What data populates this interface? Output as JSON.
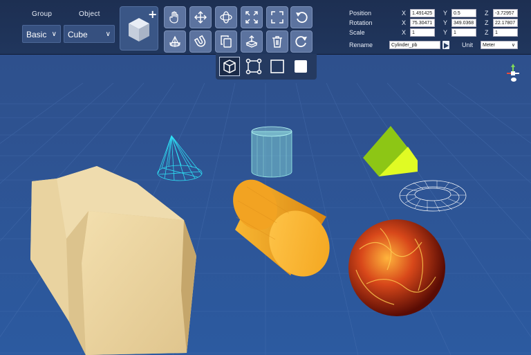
{
  "toolbar": {
    "group_header": "Group",
    "object_header": "Object",
    "group_value": "Basic",
    "object_value": "Cube",
    "tools_row1": [
      "hand-icon",
      "move-icon",
      "rotate-orbit-icon",
      "scale-expand-icon",
      "frame-icon",
      "undo-icon"
    ],
    "tools_row2": [
      "pivot-icon",
      "snap-magnet-icon",
      "duplicate-icon",
      "export-icon",
      "delete-icon",
      "redo-icon"
    ]
  },
  "transform": {
    "position_label": "Position",
    "rotation_label": "Rotation",
    "scale_label": "Scale",
    "rename_label": "Rename",
    "unit_label": "Unit",
    "axes": [
      "X",
      "Y",
      "Z"
    ],
    "position": {
      "x": "1.491425",
      "y": "0.5",
      "z": "-3.72957"
    },
    "rotation": {
      "x": "75.30471",
      "y": "349.0368",
      "z": "22.17807"
    },
    "scale": {
      "x": "1",
      "y": "1",
      "z": "1"
    },
    "rename_value": "Cylinder_pb",
    "unit_value": "Meter"
  },
  "view_modes": [
    "shaded-cube-icon",
    "wireframe-icon",
    "outline-square-icon",
    "solid-square-icon"
  ],
  "colors": {
    "toolbar_bg": "#1f3358",
    "viewport_bg": "#2e5290",
    "grid_line": "#4a73b5",
    "cone": "#28d6f0",
    "glass_cylinder": "#8fe5e0",
    "prism_light": "#d9f521",
    "prism_dark": "#8cc313",
    "cylinder": "#f4a020",
    "wood": "#e9d3a0",
    "lava": "#c83216"
  }
}
